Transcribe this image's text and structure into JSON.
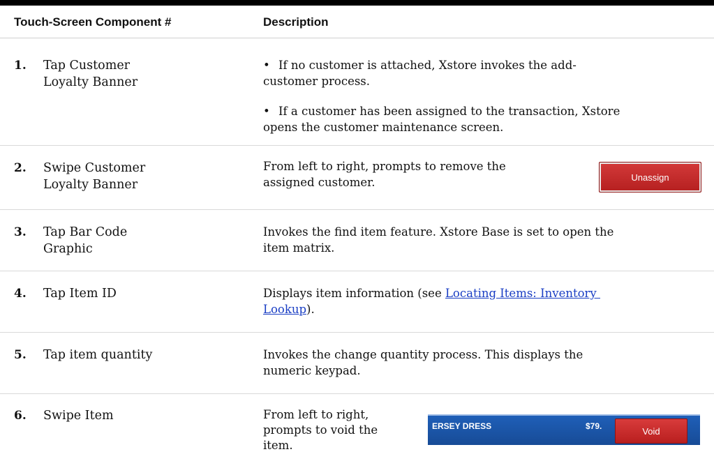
{
  "table": {
    "headers": {
      "component": "Touch-Screen Component #",
      "description": "Description"
    },
    "rows": [
      {
        "num": "1.",
        "component": "Tap Customer\nLoyalty Banner",
        "bullets": [
          "If no customer is attached, Xstore invokes the add-\ncustomer process.",
          "If a customer has been assigned to the transaction, Xstore\nopens the customer maintenance screen."
        ]
      },
      {
        "num": "2.",
        "component": "Swipe Customer\nLoyalty Banner",
        "description": "From left to right, prompts to remove the\nassigned customer.",
        "button_label": "Unassign"
      },
      {
        "num": "3.",
        "component": "Tap Bar Code\nGraphic",
        "description": "Invokes the find item feature. Xstore Base is set to open the\nitem matrix."
      },
      {
        "num": "4.",
        "component": "Tap Item ID",
        "description_prefix": "Displays item information (see ",
        "link_text_1": "Locating Items: Inventory ",
        "link_text_2": "Lookup",
        "description_suffix": ")."
      },
      {
        "num": "5.",
        "component": "Tap item quantity",
        "description": "Invokes the change quantity process. This displays the\nnumeric keypad."
      },
      {
        "num": "6.",
        "component": "Swipe Item",
        "description": "From left to right,\nprompts to void the\nitem.",
        "strip_item": "ERSEY DRESS",
        "strip_price": "$79.",
        "button_label": "Void"
      }
    ]
  }
}
